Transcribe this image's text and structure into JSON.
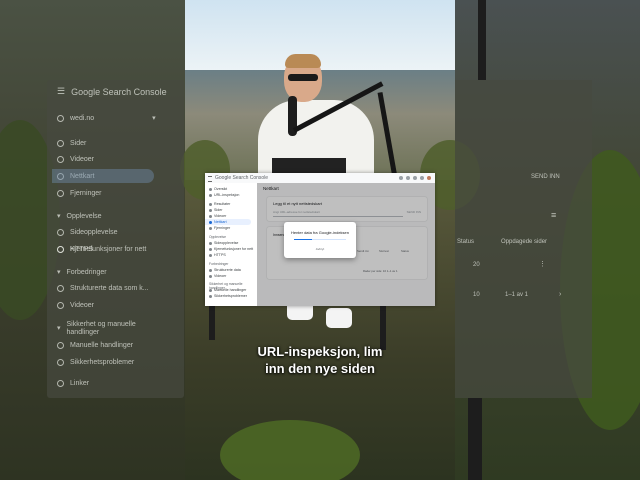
{
  "left_panel": {
    "app_title": "Google Search Console",
    "property": "wedi.no",
    "items": [
      "Sider",
      "Videoer",
      "Nettkart",
      "Fjerninger"
    ],
    "section_experience": "Opplevelse",
    "experience_items": [
      "Sideopplevelse",
      "Kjernefunksjoner for nett",
      "HTTPS"
    ],
    "section_enhancements": "Forbedringer",
    "enhancement_items": [
      "Strukturerte data som k...",
      "Videoer"
    ],
    "section_security": "Sikkerhet og manuelle handlinger",
    "security_items": [
      "Manuelle handlinger",
      "Sikkerhetsproblemer"
    ],
    "section_links": "Linker"
  },
  "right_panel": {
    "send_label": "SEND INN",
    "filter_label": "FILTER",
    "col_1": "Status",
    "col_2": "Oppdagede sider",
    "row_value": "20",
    "rows_label": "Rader per side:",
    "rows_value": "10",
    "pager": "1–1 av 1"
  },
  "console": {
    "app_title": "Google Search Console",
    "page_title": "Nettkart",
    "sidebar": {
      "items": [
        "Oversikt",
        "URL-inspeksjon",
        "Resultater",
        "Sider",
        "Videoer",
        "Nettkart",
        "Fjerninger"
      ],
      "section_experience": "Opplevelse",
      "experience_items": [
        "Sideopplevelse",
        "Kjernefunksjoner for nett",
        "HTTPS"
      ],
      "section_enhancements": "Forbedringer",
      "enhancement_items": [
        "Strukturerte data",
        "Videoer"
      ],
      "section_security": "Sikkerhet og manuelle handlinger",
      "security_items": [
        "Manuelle handlinger",
        "Sikkerhetsproblemer"
      ]
    },
    "add_sitemap_card": {
      "title": "Legg til et nytt nettstedskart",
      "placeholder": "Angi URL-adresse for nettstedskart",
      "submit": "SEND INN"
    },
    "submitted_card": {
      "title": "Innsendte nettstedskart",
      "col_type": "Type",
      "col_submitted": "Sendt inn",
      "col_read": "Sist lest",
      "col_status": "Status",
      "pager": "Rader per side: 10   1–1 av 1"
    },
    "modal": {
      "title": "Henter data fra Google-indeksen",
      "cancel": "Avbryt",
      "progress": 0.35
    }
  },
  "caption": {
    "line1": "URL-inspeksjon, lim",
    "line2": "inn den nye siden"
  }
}
